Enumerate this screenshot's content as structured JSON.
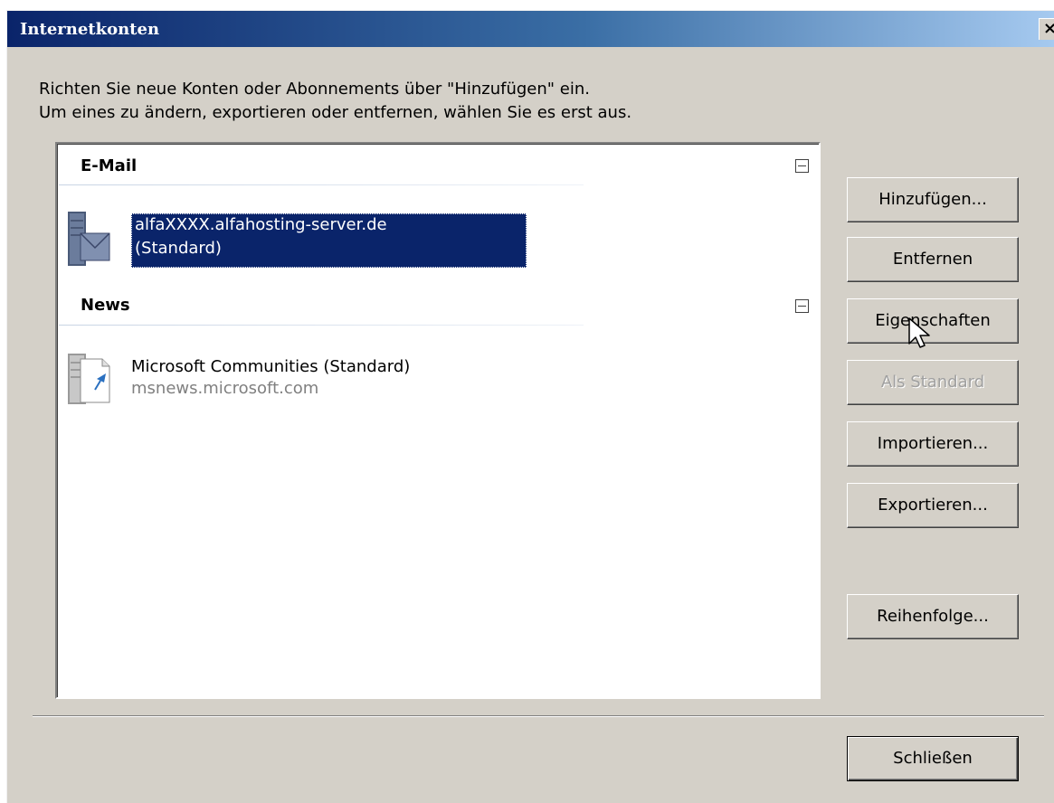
{
  "window": {
    "title": "Internetkonten",
    "close_label": "×"
  },
  "intro": {
    "line1": "Richten Sie neue Konten oder Abonnements über \"Hinzufügen\" ein.",
    "line2": "Um eines zu ändern, exportieren oder entfernen, wählen Sie es erst aus."
  },
  "accounts": {
    "email_group": {
      "label": "E-Mail",
      "collapse_icon": "minus-box-icon",
      "items": [
        {
          "name": "alfaXXXX.alfahosting-server.de",
          "detail": "(Standard)",
          "icon": "mail-server-icon",
          "selected": true
        }
      ]
    },
    "news_group": {
      "label": "News",
      "collapse_icon": "minus-box-icon",
      "items": [
        {
          "name": "Microsoft Communities (Standard)",
          "detail": "msnews.microsoft.com",
          "icon": "news-server-icon",
          "selected": false
        }
      ]
    }
  },
  "buttons": {
    "add": "Hinzufügen...",
    "remove": "Entfernen",
    "properties": "Eigenschaften",
    "set_default": "Als Standard",
    "import": "Importieren...",
    "export": "Exportieren...",
    "order": "Reihenfolge...",
    "close": "Schließen"
  },
  "colors": {
    "title_gradient_start": "#0a246a",
    "title_gradient_end": "#a6caf0",
    "selection": "#0a246a",
    "dialog_bg": "#d4d0c8"
  }
}
